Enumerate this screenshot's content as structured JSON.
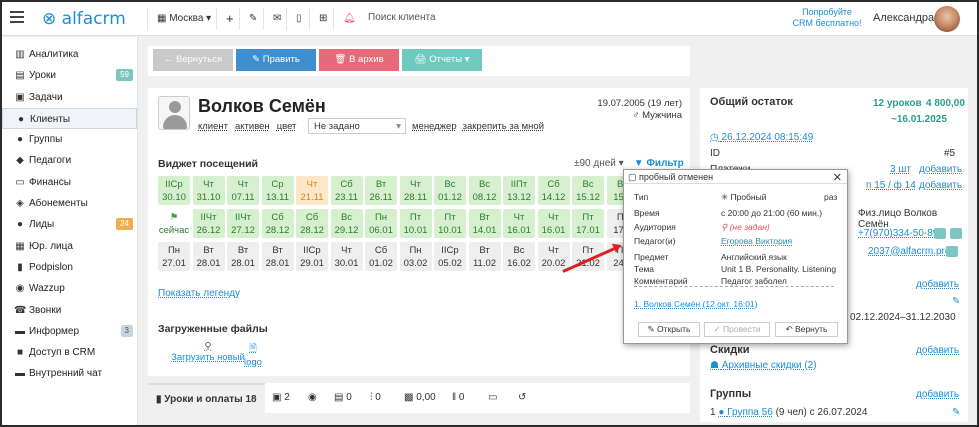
{
  "topbar": {
    "logo_text": "alfacrm",
    "city": "Москва",
    "search_placeholder": "Поиск клиента",
    "promo_line1": "Попробуйте",
    "promo_line2": "CRM бесплатно!",
    "user_name": "Александра"
  },
  "sidebar": {
    "items": [
      {
        "label": "Аналитика",
        "icon": "chart-icon"
      },
      {
        "label": "Уроки",
        "icon": "calendar-icon",
        "badge": "59"
      },
      {
        "label": "Задачи",
        "icon": "clipboard-icon"
      },
      {
        "label": "Клиенты",
        "icon": "user-icon"
      },
      {
        "label": "Группы",
        "icon": "group-icon"
      },
      {
        "label": "Педагоги",
        "icon": "teacher-icon"
      },
      {
        "label": "Финансы",
        "icon": "money-icon"
      },
      {
        "label": "Абонементы",
        "icon": "ticket-icon"
      },
      {
        "label": "Лиды",
        "icon": "leads-icon",
        "badge": "24"
      },
      {
        "label": "Юр. лица",
        "icon": "building-icon"
      },
      {
        "label": "Podpislon",
        "icon": "doc-icon"
      },
      {
        "label": "Wazzup",
        "icon": "chat-icon"
      },
      {
        "label": "Звонки",
        "icon": "phone-icon"
      },
      {
        "label": "Информер",
        "icon": "informer-icon",
        "badge": "3"
      },
      {
        "label": "Доступ в CRM",
        "icon": "lock-icon"
      },
      {
        "label": "Внутренний чат",
        "icon": "message-icon"
      }
    ]
  },
  "actions": {
    "back": "← Вернуться",
    "edit": "✎ Править",
    "archive": "🗑 В архив",
    "reports": "🖨 Отчеты ▾"
  },
  "client": {
    "name": "Волков Семён",
    "tags": [
      "клиент",
      "активен",
      "цвет"
    ],
    "select_value": "Не задано",
    "links": [
      "менеджер",
      "закрепить за мной"
    ],
    "birth": "19.07.2005 (19 лет)",
    "gender": "Мужчина"
  },
  "widget": {
    "title": "Виджет посещений",
    "period": "±90 дней ▾",
    "filter": "Фильтр",
    "now_label": "сейчас",
    "legend_link": "Показать легенду",
    "cells": [
      [
        "IIСр",
        "30.10",
        "green"
      ],
      [
        "Чт",
        "31.10",
        "green"
      ],
      [
        "Чт",
        "07.11",
        "green"
      ],
      [
        "Ср",
        "13.11",
        "green"
      ],
      [
        "Чт",
        "21.11",
        "orange"
      ],
      [
        "Сб",
        "23.11",
        "green"
      ],
      [
        "Вт",
        "26.11",
        "green"
      ],
      [
        "Чт",
        "28.11",
        "green"
      ],
      [
        "Вс",
        "01.12",
        "green"
      ],
      [
        "Вс",
        "08.12",
        "green"
      ],
      [
        "IIПт",
        "13.12",
        "green"
      ],
      [
        "Сб",
        "14.12",
        "green"
      ],
      [
        "Вс",
        "15.12",
        "green"
      ],
      [
        "Вс",
        "15.1",
        "green"
      ],
      [
        "",
        "",
        "now"
      ],
      [
        "IIЧт",
        "26.12",
        "green"
      ],
      [
        "IIЧт",
        "27.12",
        "green"
      ],
      [
        "Сб",
        "28.12",
        "green"
      ],
      [
        "Сб",
        "28.12",
        "green"
      ],
      [
        "Вс",
        "29.12",
        "green"
      ],
      [
        "Пн",
        "06.01",
        "green"
      ],
      [
        "Пт",
        "10.01",
        "green"
      ],
      [
        "Пт",
        "10.01",
        "green"
      ],
      [
        "Вт",
        "14.01",
        "green"
      ],
      [
        "Чт",
        "16.01",
        "green"
      ],
      [
        "Чт",
        "16.01",
        "green"
      ],
      [
        "Пт",
        "17.01",
        "green"
      ],
      [
        "Пт",
        "17.0",
        "grey"
      ],
      [
        "Пн",
        "27.01",
        "grey"
      ],
      [
        "Вт",
        "28.01",
        "grey"
      ],
      [
        "Вт",
        "28.01",
        "grey"
      ],
      [
        "Вт",
        "28.01",
        "grey"
      ],
      [
        "IIСр",
        "29.01",
        "grey"
      ],
      [
        "Чт",
        "30.01",
        "grey"
      ],
      [
        "Сб",
        "01.02",
        "grey"
      ],
      [
        "Пн",
        "03.02",
        "grey"
      ],
      [
        "IIСр",
        "05.02",
        "grey"
      ],
      [
        "Вт",
        "11.02",
        "grey"
      ],
      [
        "Вс",
        "16.02",
        "grey"
      ],
      [
        "Чт",
        "20.02",
        "grey"
      ],
      [
        "Пт",
        "21.02",
        "grey"
      ],
      [
        "Пн",
        "24.0",
        "grey"
      ]
    ]
  },
  "files": {
    "title": "Загруженные файлы",
    "upload": "Загрузить новый",
    "file": "logo"
  },
  "tabs": [
    {
      "label": "Уроки и оплаты 18"
    },
    {
      "label": "2"
    },
    {
      "label": ""
    },
    {
      "label": "0"
    },
    {
      "label": "0"
    },
    {
      "label": "0,00"
    },
    {
      "label": "0"
    },
    {
      "label": ""
    },
    {
      "label": ""
    }
  ],
  "balance": {
    "title": "Общий остаток",
    "lessons": "12 уроков",
    "amount": "4 800,00",
    "until": "~16.01.2025",
    "date_link": "26.12.2024 08:15:49",
    "id_label": "ID",
    "id_value": "#5",
    "payments_label": "Платежи",
    "payments_count": "3 шт",
    "add": "добавить",
    "sub_link": "п 15 / ф 14",
    "entity_label": "Физ.лицо Волков Семён",
    "phone": "+7(970)334-50-89",
    "email": "2037@alfacrm.pro",
    "period": "02.12.2024–31.12.2030",
    "discounts_title": "Скидки",
    "discounts_archive": "Архивные скидки (2)",
    "groups_title": "Группы",
    "group_link": "Группа 56",
    "group_suffix": "(9 чел) с 26.07.2024",
    "group_num": "1"
  },
  "popup": {
    "title": "пробный отменен",
    "labels": [
      "Тип",
      "Время",
      "Аудитория",
      "Педагог(и)",
      "Предмет",
      "Тема",
      "Комментарий"
    ],
    "values": [
      "Пробный",
      "с 20:00 до 21:00 (60 мин.)",
      "(не задан)",
      "Егорова Виктория",
      "Английский язык",
      "Unit 1 B. Personality. Listening",
      "Педагог заболел"
    ],
    "type_extra": "раз",
    "client_link": "1. Волков Семён (12 окт. 16:01)",
    "btn_open": "Открыть",
    "btn_conduct": "Провести",
    "btn_return": "Вернуть"
  }
}
